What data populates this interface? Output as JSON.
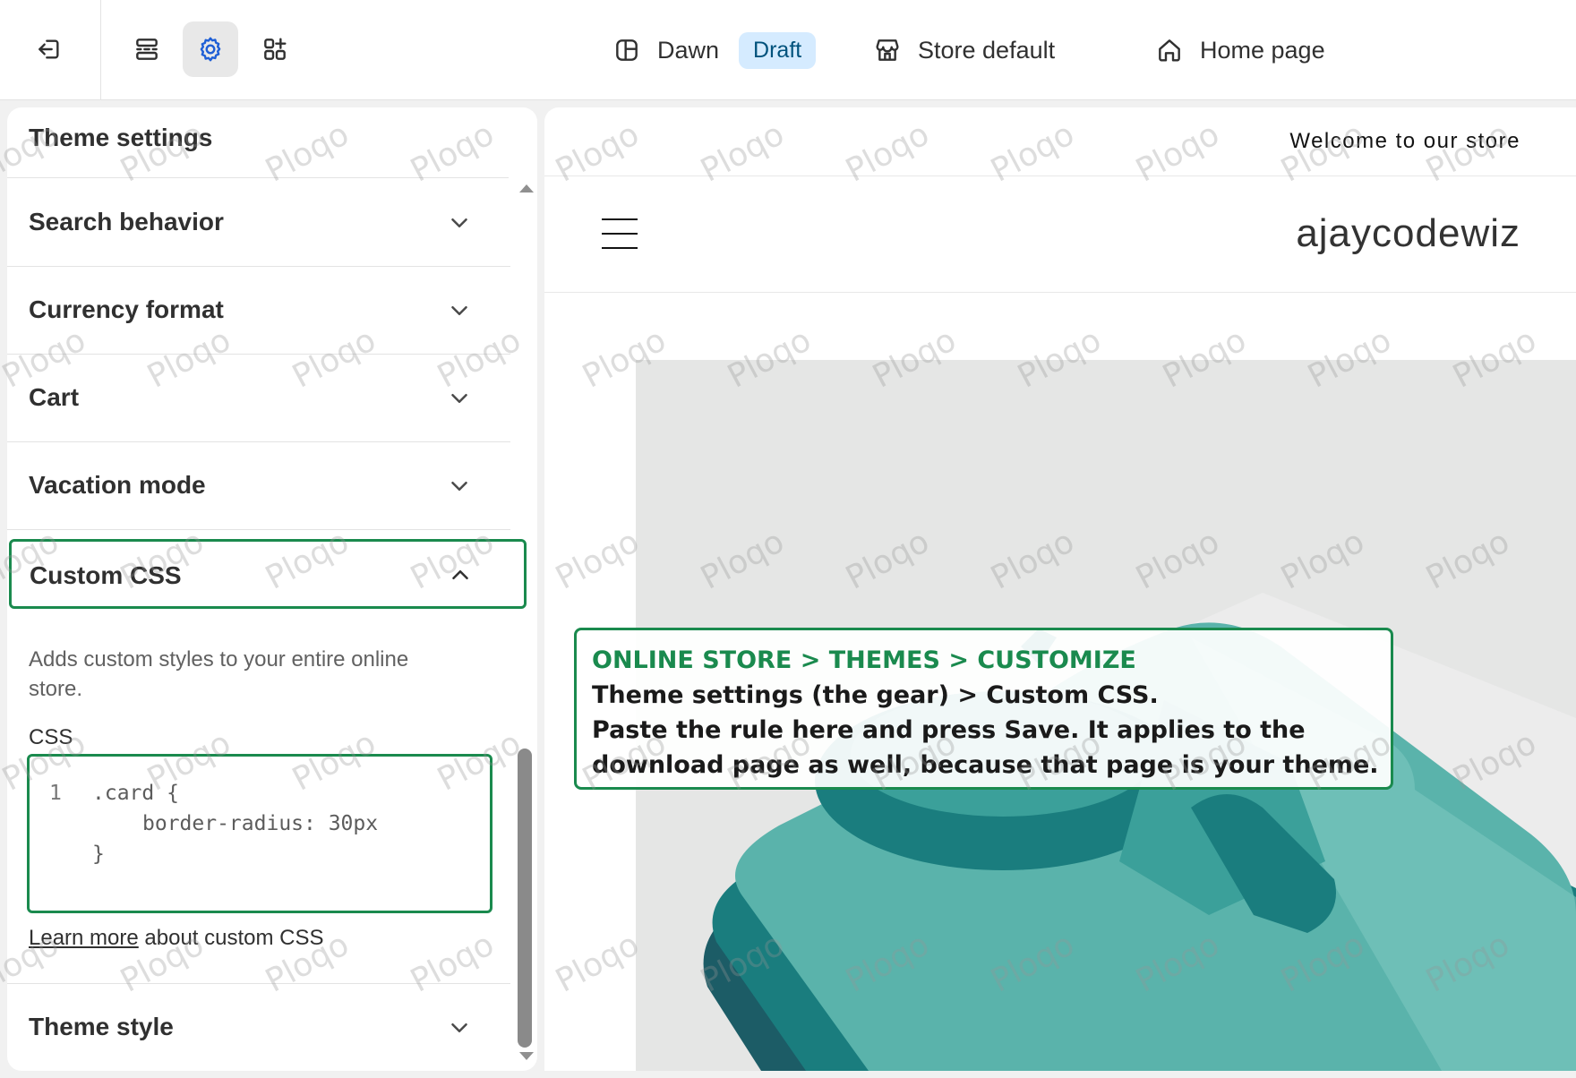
{
  "topbar": {
    "theme_name": "Dawn",
    "theme_status": "Draft",
    "store_context": "Store default",
    "page_selector": "Home page",
    "icons": [
      "exit-icon",
      "sections-icon",
      "gear-icon",
      "app-blocks-icon",
      "layout-icon",
      "store-icon",
      "home-icon"
    ]
  },
  "sidebar": {
    "title": "Theme settings",
    "sections": [
      {
        "label": "Search behavior"
      },
      {
        "label": "Currency format"
      },
      {
        "label": "Cart"
      },
      {
        "label": "Vacation mode"
      }
    ],
    "custom_css": {
      "label": "Custom CSS",
      "description": "Adds custom styles to your entire online store.",
      "field_label": "CSS",
      "code_line_number": "1",
      "code_line1": ".card {",
      "code_line2": "border-radius: 30px",
      "code_line3": "}",
      "learn_link": "Learn more",
      "learn_suffix": " about custom CSS"
    },
    "last_section": {
      "label": "Theme style"
    }
  },
  "preview": {
    "announcement": "Welcome to our store",
    "store_name": "ajaycodewiz"
  },
  "callout": {
    "heading": "ONLINE STORE > THEMES > CUSTOMIZE",
    "line1": "Theme settings (the gear) > Custom CSS.",
    "line2": "Paste the rule here and press Save. It applies to the",
    "line3": "download page as well, because that page is your theme."
  },
  "watermark": "Ploqo",
  "colors": {
    "accent_green": "#1a8a4e",
    "draft_bg": "#d5ebff",
    "draft_text": "#00527c",
    "active_gear": "#1f5fd6",
    "hero_teal": "#5ab3ab"
  }
}
